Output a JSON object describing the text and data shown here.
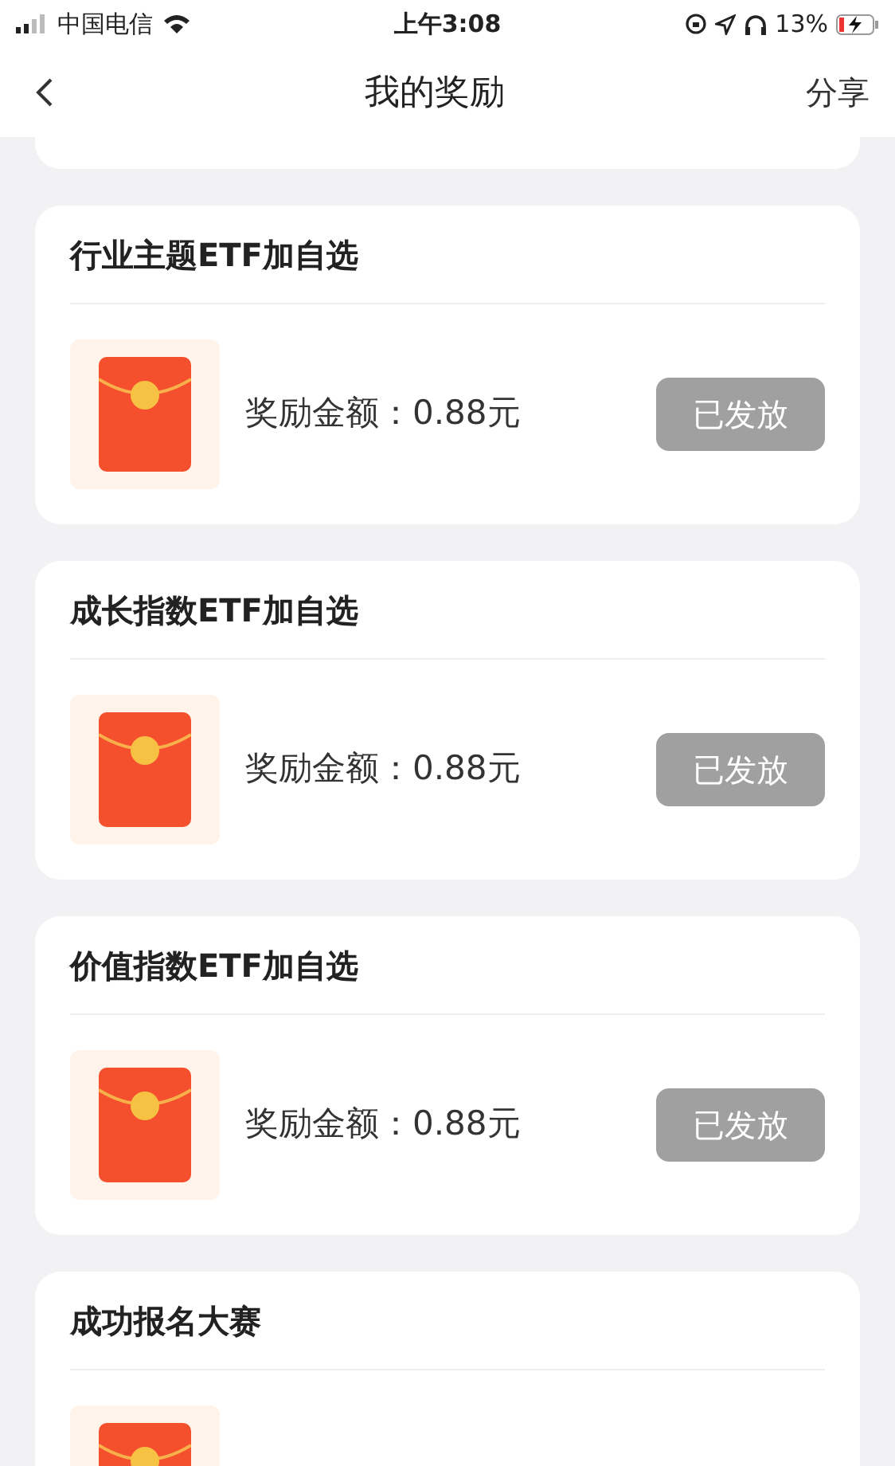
{
  "status_bar": {
    "carrier": "中国电信",
    "time": "上午3:08",
    "battery": "13%"
  },
  "nav": {
    "title": "我的奖励",
    "action": "分享"
  },
  "rewards": [
    {
      "title": "行业主题ETF加自选",
      "amount": "奖励金额：0.88元",
      "status": "已发放"
    },
    {
      "title": "成长指数ETF加自选",
      "amount": "奖励金额：0.88元",
      "status": "已发放"
    },
    {
      "title": "价值指数ETF加自选",
      "amount": "奖励金额：0.88元",
      "status": "已发放"
    },
    {
      "title": "成功报名大赛"
    }
  ]
}
